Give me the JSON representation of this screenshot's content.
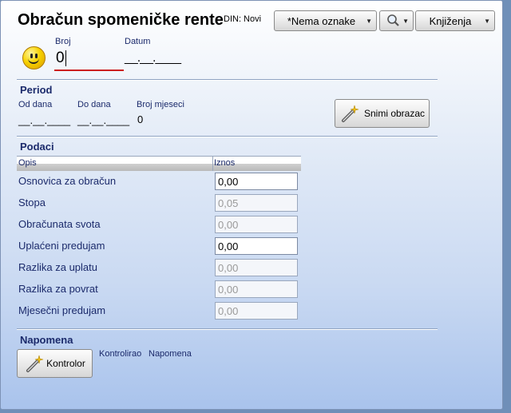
{
  "header": {
    "title": "Obračun spomeničke rente",
    "status": "DIN: Novi"
  },
  "toolbar": {
    "tag_select": "*Nema oznake",
    "postings_button": "Knjiženja"
  },
  "document": {
    "number_label": "Broj",
    "number_value": "0",
    "date_label": "Datum",
    "date_value": "__.__.____"
  },
  "period": {
    "heading": "Period",
    "from_label": "Od dana",
    "from_value": "__.__.____",
    "to_label": "Do dana",
    "to_value": "__.__.____",
    "months_label": "Broj mjeseci",
    "months_value": "0",
    "save_button": "Snimi obrazac"
  },
  "data": {
    "heading": "Podaci",
    "col_desc": "Opis",
    "col_amount": "Iznos",
    "rows": [
      {
        "label": "Osnovica za obračun",
        "value": "0,00"
      },
      {
        "label": "Stopa",
        "value": "0,05"
      },
      {
        "label": "Obračunata svota",
        "value": "0,00"
      },
      {
        "label": "Uplaćeni predujam",
        "value": "0,00"
      },
      {
        "label": "Razlika za uplatu",
        "value": "0,00"
      },
      {
        "label": "Razlika za povrat",
        "value": "0,00"
      },
      {
        "label": "Mjesečni predujam",
        "value": "0,00"
      }
    ]
  },
  "note": {
    "heading": "Napomena",
    "control_button": "Kontrolor",
    "controlled_label": "Kontrolirao",
    "note_label": "Napomena"
  },
  "colors": {
    "accent_underline": "#cc1f1f",
    "text": "#1b2a6b"
  },
  "icons": [
    "smiley-icon",
    "search-icon",
    "wand-icon"
  ]
}
